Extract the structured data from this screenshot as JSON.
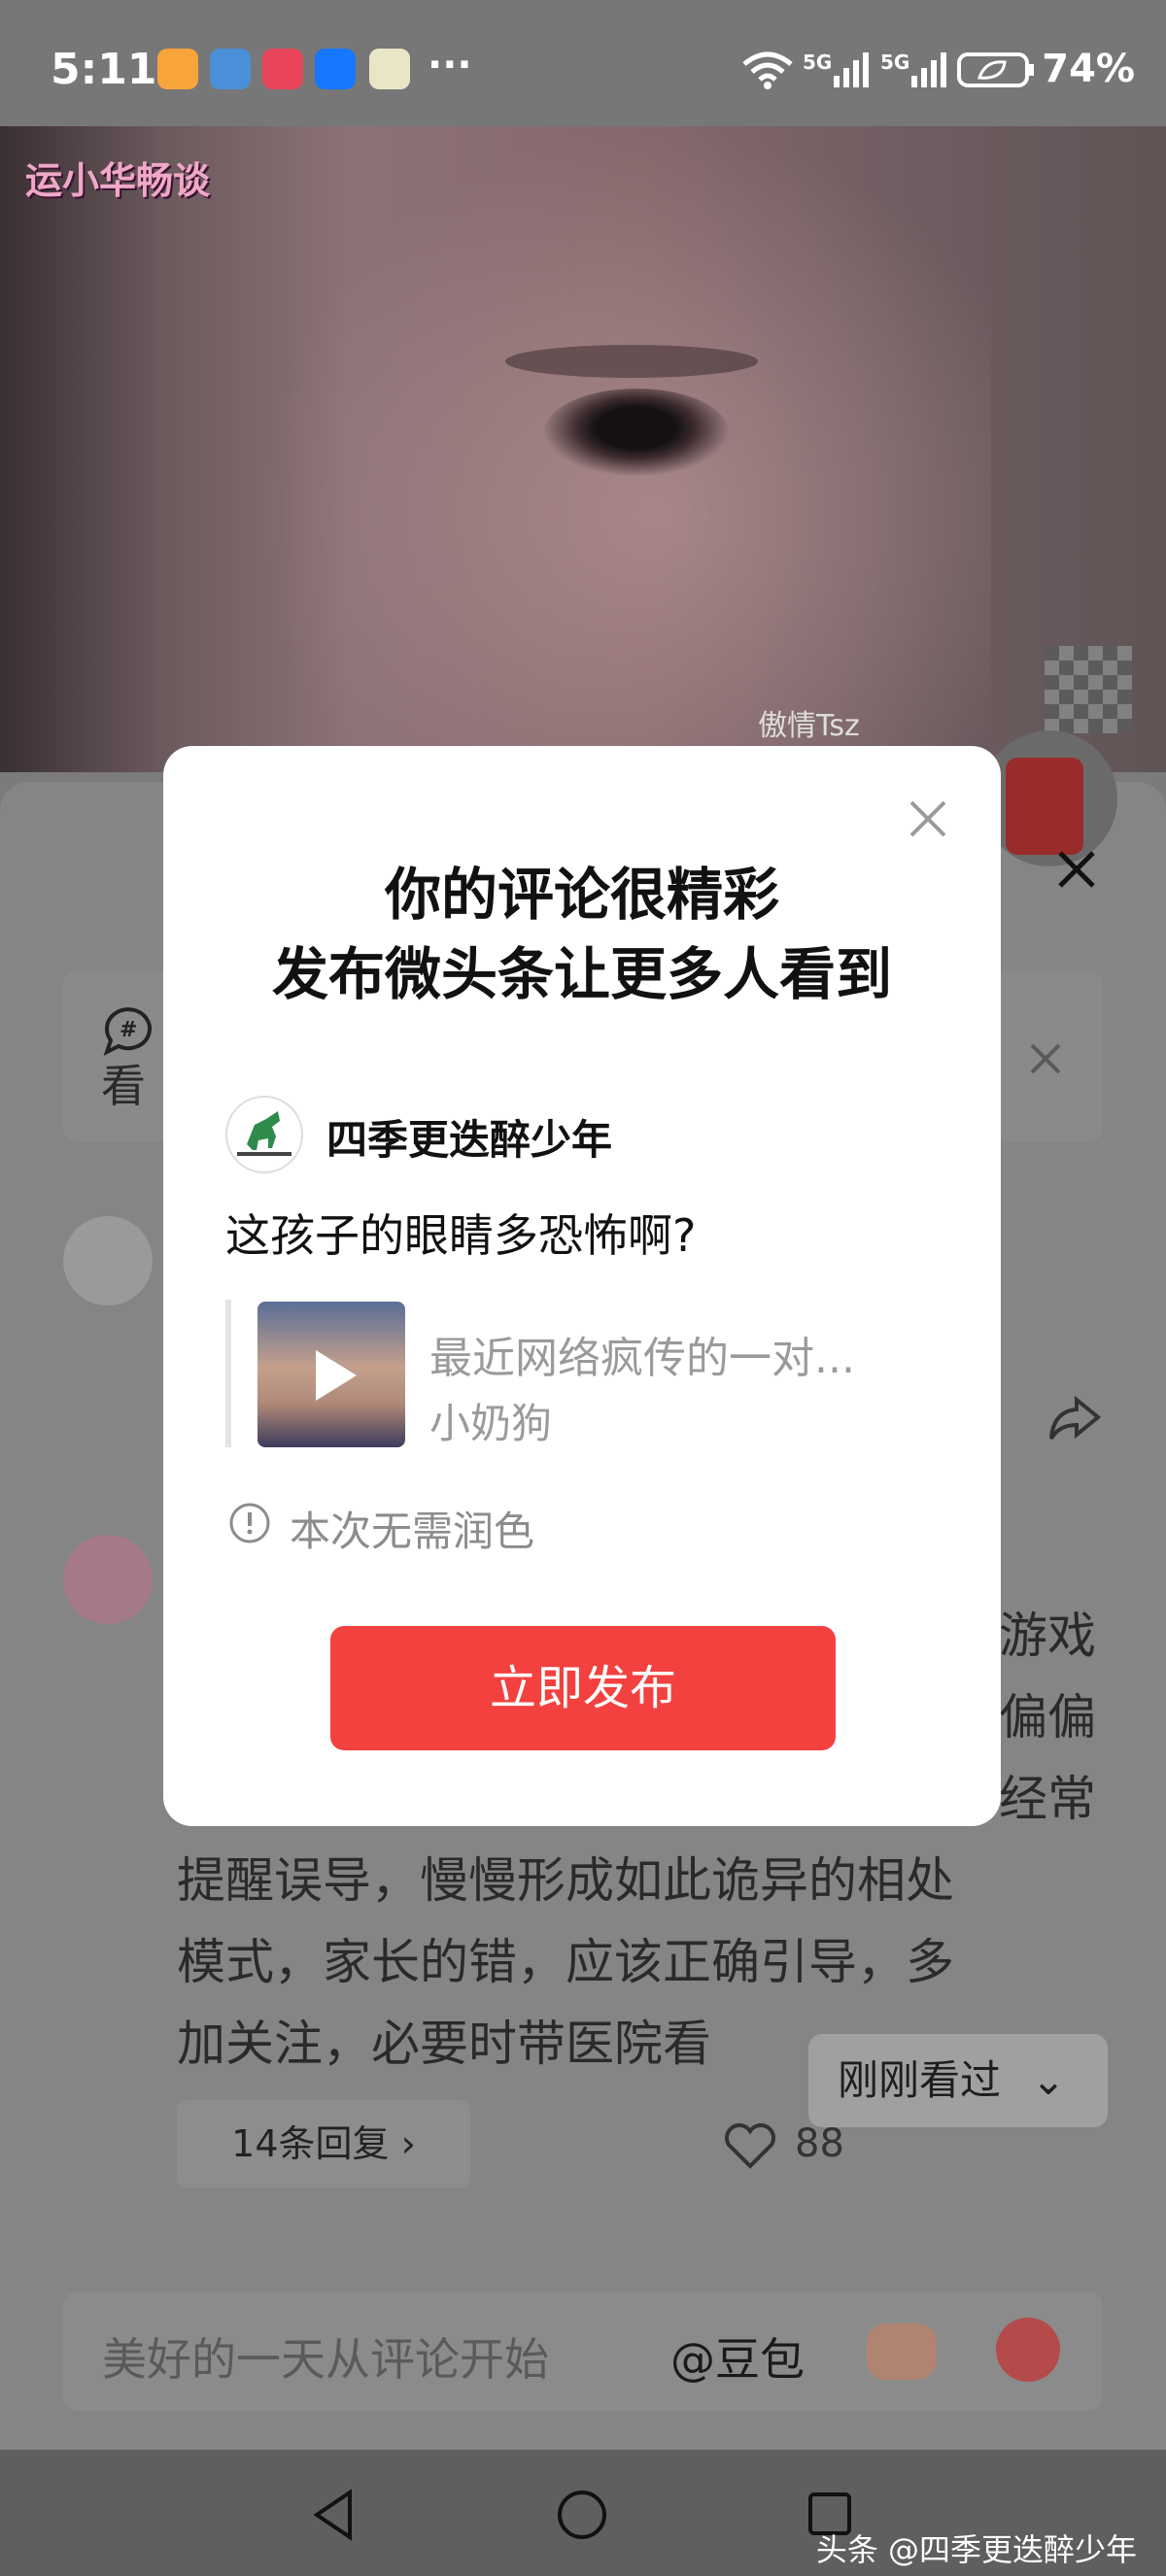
{
  "status_bar": {
    "time": "5:11",
    "more": "···",
    "network_1": "5G",
    "network_2": "5G",
    "battery": "74%"
  },
  "video": {
    "watermark_top": "运小华畅谈",
    "watermark_bottom": "傲情Tsz"
  },
  "background": {
    "hashtag_snippet": "看",
    "comment_lines": [
      "游戏",
      "偏偏",
      "经常",
      "提醒误导，慢慢形成如此诡异的相处",
      "模式，家长的错，应该正确引导，多",
      "加关注，必要时带医院看"
    ],
    "replies_label": "14条回复 ›",
    "like_count": "88",
    "recently_viewed": "刚刚看过",
    "input_placeholder": "美好的一天从评论开始",
    "doubao": "@豆包",
    "toutiao_watermark": "头条 @四季更迭醉少年"
  },
  "modal": {
    "title_line1": "你的评论很精彩",
    "title_line2": "发布微头条让更多人看到",
    "username": "四季更迭醉少年",
    "comment": "这孩子的眼睛多恐怖啊?",
    "quote_title": "最近网络疯传的一对...",
    "quote_author": "小奶狗",
    "info": "本次无需润色",
    "publish_button": "立即发布"
  },
  "colors": {
    "accent_red": "#f3413f",
    "overlay_gray": "#858585"
  }
}
